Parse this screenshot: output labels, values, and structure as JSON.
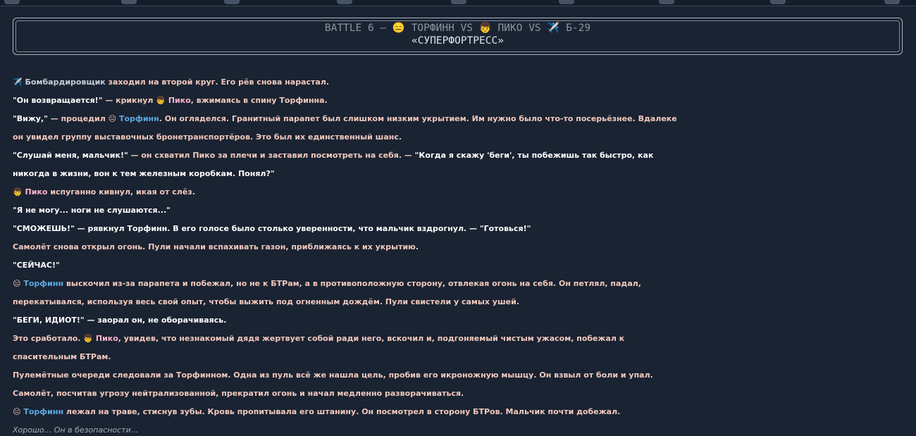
{
  "colors": {
    "background": "#1a2332",
    "narration": "#f2c9bd",
    "dialogue": "#ffffff",
    "torfinn": "#5ba9e3",
    "piko": "#ffb4cc",
    "bomber": "#c6cdd6",
    "thought": "#a4adb9"
  },
  "icons": [
    "airplane-emoji",
    "boy-emoji",
    "expressionless-face-emoji"
  ],
  "header": {
    "battle": "BATTLE 6 –",
    "vs": "VS",
    "torfinn_emoji": "😑",
    "torfinn": "ТОРФИНН",
    "piko_emoji": "👦",
    "piko": "ПИКО",
    "plane_emoji": "✈️",
    "plane": "Б-29",
    "subtitle": "«СУПЕРФОРТРЕСС»"
  },
  "story": {
    "l1_name": "Бомбардировщик",
    "l1_text": " заходил на второй круг. Его рёв снова нарастал.",
    "l2_q": "\"Он возвращается!\"",
    "l2_a": " — крикнул ",
    "l2_name": "Пико",
    "l2_b": ", вжимаясь в спину Торфинна.",
    "l3_q": "\"Вижу,\"",
    "l3_a": " — процедил ",
    "l3_name": "Торфинн",
    "l3_b": ". Он огляделся. Гранитный парапет был слишком низким укрытием. Им нужно было что-то посерьёзнее. Вдалеке",
    "l4": "он увидел группу выставочных бронетранспортёров. Это был их единственный шанс.",
    "l5_q": "\"Слушай меня, мальчик!\"",
    "l5_a": " — он схватил Пико за плечи и заставил посмотреть на себя. — ",
    "l5_q2": "\"Когда я скажу 'беги', ты побежишь так быстро, как",
    "l6_q": "никогда в жизни, вон к тем железным коробкам. Понял?\"",
    "l7_name": "Пико",
    "l7_text": " испуганно кивнул, икая от слёз.",
    "l8_q": "\"Я не могу... ноги не слушаются...\"",
    "l9_q": "\"СМОЖЕШЬ!\"",
    "l9_a": " — рявкнул Торфинн. В его голосе было столько уверенности, что мальчик вздрогнул. — ",
    "l9_q2": "\"Готовься!\"",
    "l10": "Самолёт снова открыл огонь. Пули начали вспахивать газон, приближаясь к их укрытию.",
    "l11_q": "\"СЕЙЧАС!\"",
    "l12_name": "Торфинн",
    "l12_text": " выскочил из-за парапета и побежал, но не к БТРам, а в противоположную сторону, отвлекая огонь на себя. Он петлял, падал,",
    "l13": "перекатывался, используя весь свой опыт, чтобы выжить под огненным дождём. Пули свистели у самых ушей.",
    "l14_q": "\"БЕГИ, ИДИОТ!\"",
    "l14_a": " — заорал он, не оборачиваясь.",
    "l15_a": "Это сработало. ",
    "l15_name": "Пико",
    "l15_b": ", увидев, что незнакомый дядя жертвует собой ради него, вскочил и, подгоняемый чистым ужасом, побежал к",
    "l16": "спасительным БТРам.",
    "l17": "Пулемётные очереди следовали за Торфинном. Одна из пуль всё же нашла цель, пробив его икроножную мышцу. Он взвыл от боли и упал.",
    "l18": "Самолёт, посчитав угрозу нейтрализованной, прекратил огонь и начал медленно разворачиваться.",
    "l19_name": "Торфинн",
    "l19_text": " лежал на траве, стиснув зубы. Кровь пропитывала его штанину. Он посмотрел в сторону БТРов. Мальчик почти добежал.",
    "l20": "Хорошо... Он в безопасности..."
  }
}
